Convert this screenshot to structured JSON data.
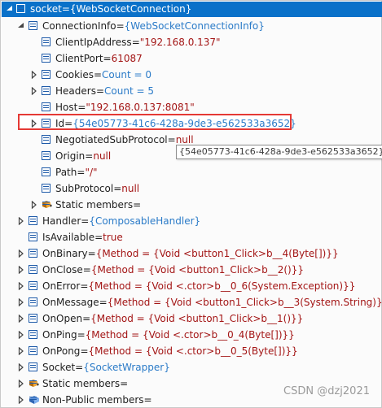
{
  "root": {
    "name": "socket",
    "value": "{WebSocketConnection}"
  },
  "rows": [
    {
      "name": "ConnectionInfo",
      "value": "{WebSocketConnectionInfo}",
      "vtype": "type"
    },
    {
      "name": "ClientIpAddress",
      "value": "\"192.168.0.137\"",
      "vtype": "str"
    },
    {
      "name": "ClientPort",
      "value": "61087",
      "vtype": "str"
    },
    {
      "name": "Cookies",
      "value": "Count = 0",
      "vtype": "type"
    },
    {
      "name": "Headers",
      "value": "Count = 5",
      "vtype": "type"
    },
    {
      "name": "Host",
      "value": "\"192.168.0.137:8081\"",
      "vtype": "str"
    },
    {
      "name": "Id",
      "value": "{54e05773-41c6-428a-9de3-e562533a3652}",
      "vtype": "type"
    },
    {
      "name": "NegotiatedSubProtocol",
      "value": "null",
      "vtype": "str"
    },
    {
      "name": "Origin",
      "value": "null",
      "vtype": "str"
    },
    {
      "name": "Path",
      "value": "\"/\"",
      "vtype": "str"
    },
    {
      "name": "SubProtocol",
      "value": "null",
      "vtype": "str"
    },
    {
      "name": "Static members",
      "value": "",
      "vtype": "str"
    },
    {
      "name": "Handler",
      "value": "{ComposableHandler}",
      "vtype": "type"
    },
    {
      "name": "IsAvailable",
      "value": "true",
      "vtype": "str"
    },
    {
      "name": "OnBinary",
      "value": "{Method = {Void <button1_Click>b__4(Byte[])}}",
      "vtype": "str"
    },
    {
      "name": "OnClose",
      "value": "{Method = {Void <button1_Click>b__2()}}",
      "vtype": "str"
    },
    {
      "name": "OnError",
      "value": "{Method = {Void <.ctor>b__0_6(System.Exception)}}",
      "vtype": "str"
    },
    {
      "name": "OnMessage",
      "value": "{Method = {Void <button1_Click>b__3(System.String)}}",
      "vtype": "str"
    },
    {
      "name": "OnOpen",
      "value": "{Method = {Void <button1_Click>b__1()}}",
      "vtype": "str"
    },
    {
      "name": "OnPing",
      "value": "{Method = {Void <.ctor>b__0_4(Byte[])}}",
      "vtype": "str"
    },
    {
      "name": "OnPong",
      "value": "{Method = {Void <.ctor>b__0_5(Byte[])}}",
      "vtype": "str"
    },
    {
      "name": "Socket",
      "value": "{SocketWrapper}",
      "vtype": "type"
    },
    {
      "name": "Static members",
      "value": "",
      "vtype": "str"
    },
    {
      "name": "Non-Public members",
      "value": "",
      "vtype": "str"
    }
  ],
  "tooltip": "{54e05773-41c6-428a-9de3-e562533a3652}",
  "watermark": "CSDN @dzj2021",
  "colors": {
    "header_bg": "#0a71c9",
    "highlight_border": "#e53935",
    "string_value": "#a31515",
    "type_value": "#2b7bc8"
  }
}
